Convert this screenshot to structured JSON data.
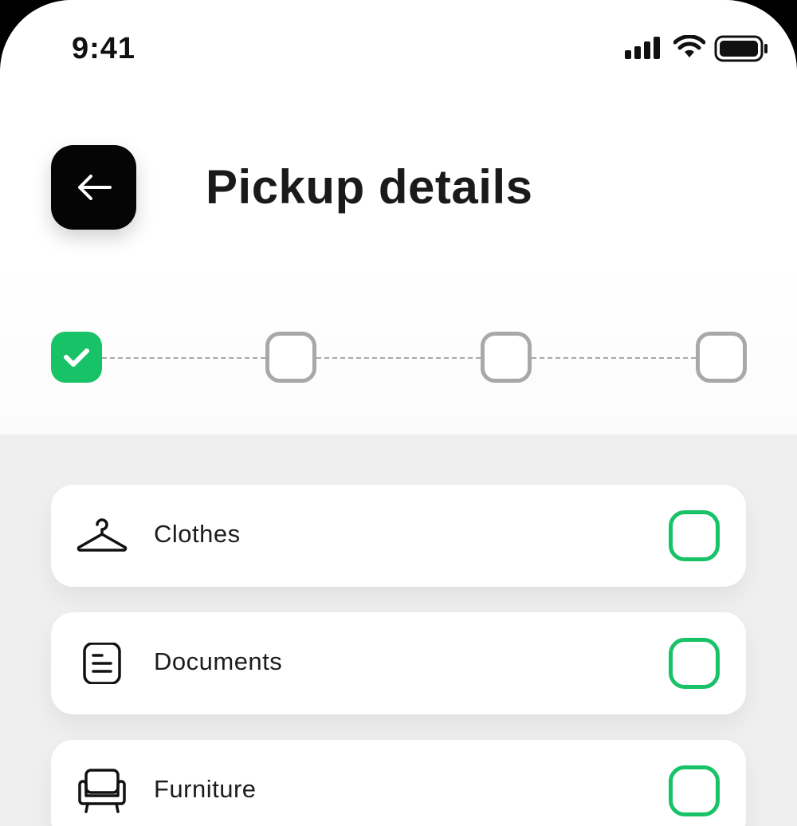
{
  "status_bar": {
    "time": "9:41",
    "signal_icon": "cellular-signal-icon",
    "wifi_icon": "wifi-icon",
    "battery_icon": "battery-icon"
  },
  "header": {
    "back_icon": "arrow-left-icon",
    "title": "Pickup details"
  },
  "stepper": {
    "total_steps": 4,
    "completed_steps": 1
  },
  "items": [
    {
      "label": "Clothes",
      "icon": "hanger-icon",
      "checked": false
    },
    {
      "label": "Documents",
      "icon": "document-icon",
      "checked": false
    },
    {
      "label": "Furniture",
      "icon": "armchair-icon",
      "checked": false
    }
  ],
  "colors": {
    "accent": "#18c266",
    "pending": "#a8a8a8",
    "back_button": "#050505",
    "title": "#1a1a1a"
  }
}
